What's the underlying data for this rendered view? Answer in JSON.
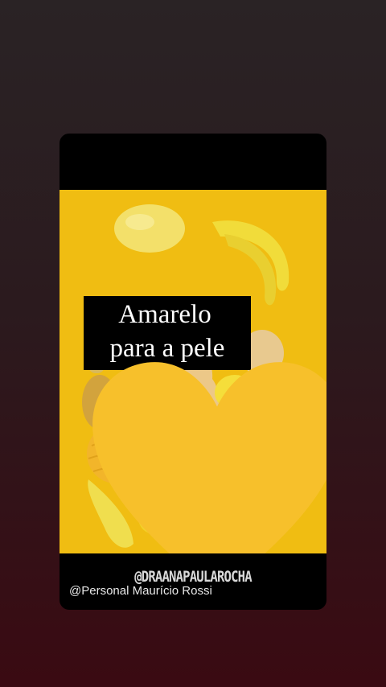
{
  "story": {
    "caption_line1": "Amarelo",
    "caption_line2": "para a pele",
    "caption_emoji": "yellow-heart-icon",
    "handle": "@DRAANAPAULAROCHA",
    "credit": "@Personal Maurício Rossi"
  },
  "colors": {
    "background_top": "#2a2325",
    "background_bottom": "#3a0a12",
    "photo_background": "#f0bd12"
  }
}
